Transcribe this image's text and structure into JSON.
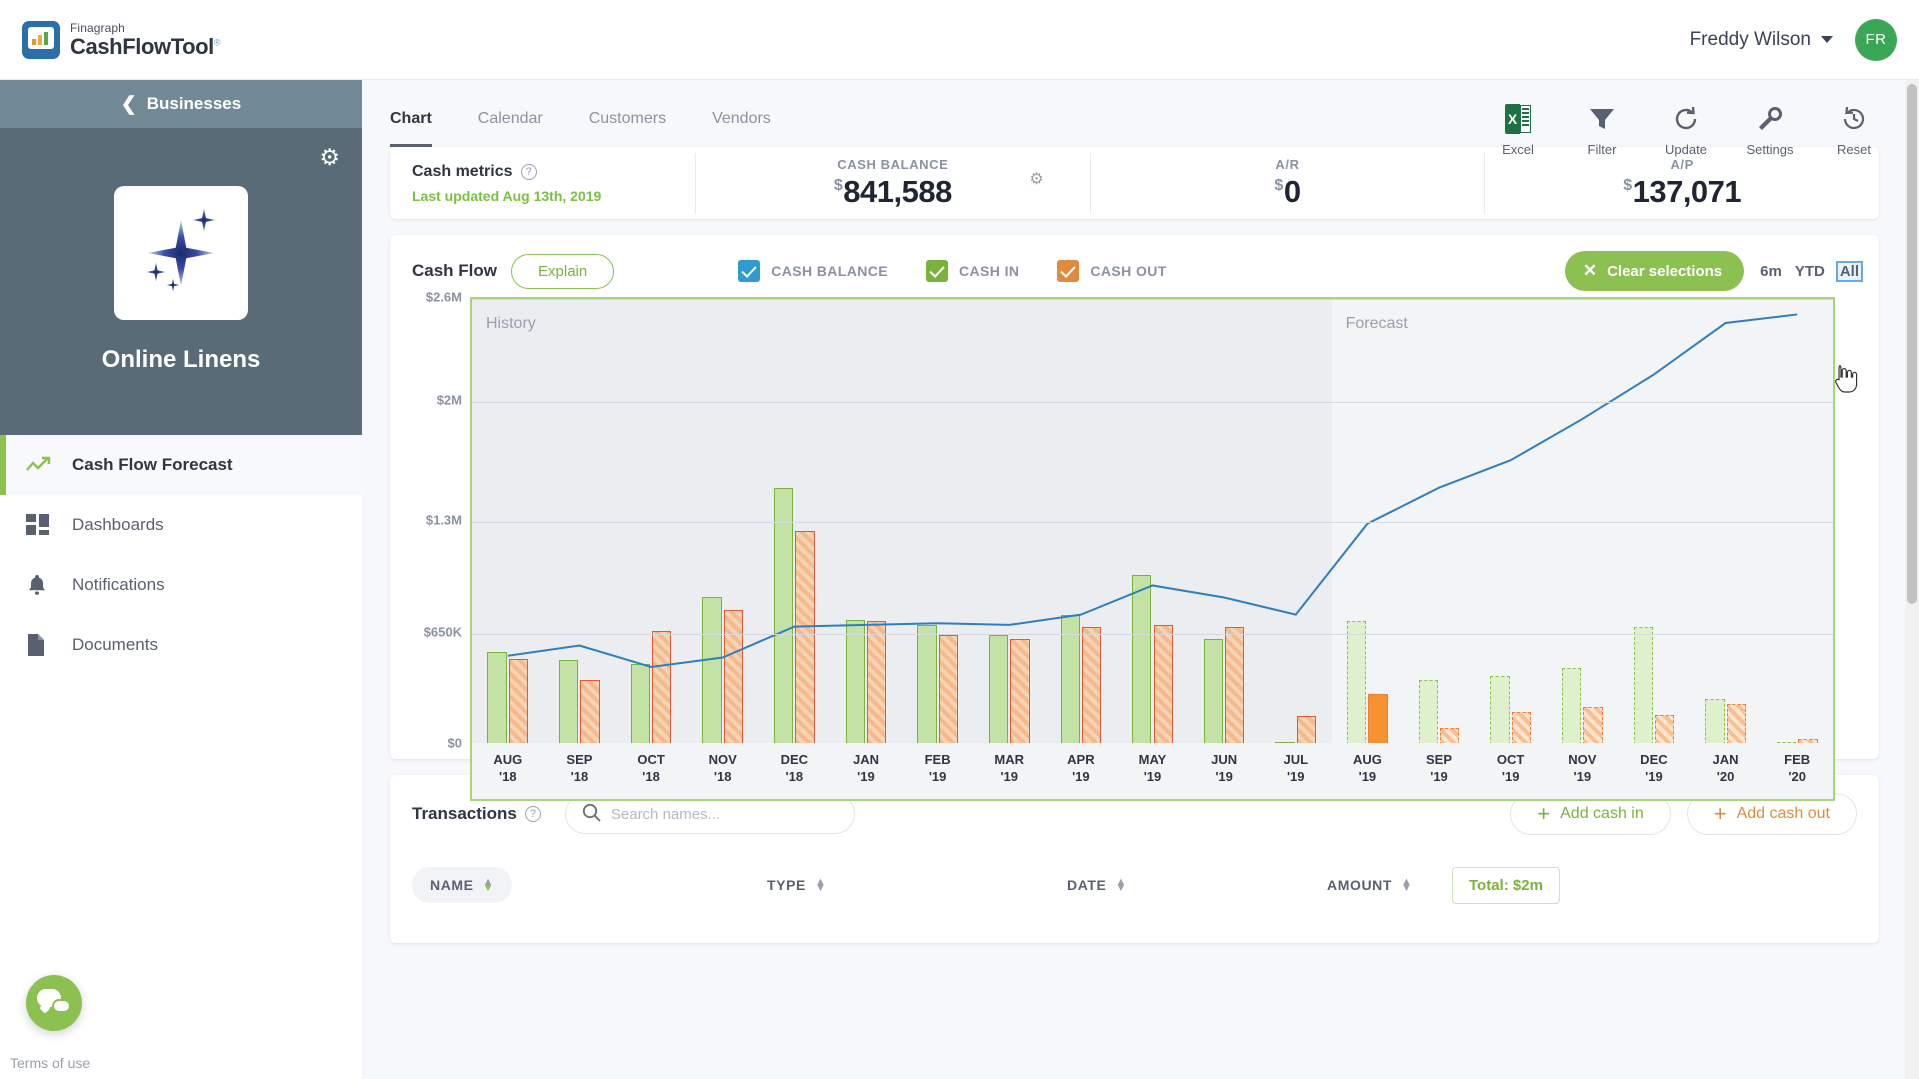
{
  "brand": {
    "top": "Finagraph",
    "bottom": "CashFlowTool",
    "tm": "®"
  },
  "topbar": {
    "user_name": "Freddy Wilson",
    "avatar_initials": "FR"
  },
  "sidebar": {
    "back_label": "Businesses",
    "business_name": "Online Linens",
    "items": [
      {
        "label": "Cash Flow Forecast",
        "icon": "trend-up-icon"
      },
      {
        "label": "Dashboards",
        "icon": "grid-icon"
      },
      {
        "label": "Notifications",
        "icon": "bell-icon"
      },
      {
        "label": "Documents",
        "icon": "document-icon"
      }
    ],
    "terms": "Terms of use"
  },
  "tabs": [
    {
      "label": "Chart",
      "active": true
    },
    {
      "label": "Calendar",
      "active": false
    },
    {
      "label": "Customers",
      "active": false
    },
    {
      "label": "Vendors",
      "active": false
    }
  ],
  "toolbar": [
    {
      "label": "Excel",
      "icon": "excel-icon"
    },
    {
      "label": "Filter",
      "icon": "funnel-icon"
    },
    {
      "label": "Update",
      "icon": "refresh-icon"
    },
    {
      "label": "Settings",
      "icon": "wrench-icon"
    },
    {
      "label": "Reset",
      "icon": "history-icon"
    }
  ],
  "metrics": {
    "title": "Cash metrics",
    "last_updated": "Last updated Aug 13th, 2019",
    "cells": [
      {
        "label": "CASH BALANCE",
        "dollar": "$",
        "value": "841,588"
      },
      {
        "label": "A/R",
        "dollar": "$",
        "value": "0"
      },
      {
        "label": "A/P",
        "dollar": "$",
        "value": "137,071"
      }
    ]
  },
  "chart_panel": {
    "title": "Cash Flow",
    "explain_label": "Explain",
    "legend": [
      {
        "label": "CASH BALANCE",
        "color": "#2f9bd0",
        "checked": true
      },
      {
        "label": "CASH IN",
        "color": "#7ab33c",
        "checked": true
      },
      {
        "label": "CASH OUT",
        "color": "#e08b3e",
        "checked": true
      }
    ],
    "clear_label": "Clear selections",
    "ranges": [
      {
        "label": "6m",
        "selected": false
      },
      {
        "label": "YTD",
        "selected": false
      },
      {
        "label": "All",
        "selected": true
      }
    ]
  },
  "chart_data": {
    "type": "bar",
    "title": "Cash Flow",
    "xlabel": "",
    "ylabel": "",
    "ylim": [
      0,
      2600000
    ],
    "grid": true,
    "legend_position": "top",
    "ytick_labels": [
      "$0",
      "$650K",
      "$1.3M",
      "$2M",
      "$2.6M"
    ],
    "ytick_values": [
      0,
      650000,
      1300000,
      2000000,
      2600000
    ],
    "zones": [
      {
        "label": "History",
        "from": "AUG '18",
        "to": "JUL '19"
      },
      {
        "label": "Forecast",
        "from": "AUG '19",
        "to": "FEB '20"
      }
    ],
    "categories": [
      "AUG '18",
      "SEP '18",
      "OCT '18",
      "NOV '18",
      "DEC '18",
      "JAN '19",
      "FEB '19",
      "MAR '19",
      "APR '19",
      "MAY '19",
      "JUN '19",
      "JUL '19",
      "AUG '19",
      "SEP '19",
      "OCT '19",
      "NOV '19",
      "DEC '19",
      "JAN '20",
      "FEB '20"
    ],
    "category_labels": [
      [
        "AUG",
        "'18"
      ],
      [
        "SEP",
        "'18"
      ],
      [
        "OCT",
        "'18"
      ],
      [
        "NOV",
        "'18"
      ],
      [
        "DEC",
        "'18"
      ],
      [
        "JAN",
        "'19"
      ],
      [
        "FEB",
        "'19"
      ],
      [
        "MAR",
        "'19"
      ],
      [
        "APR",
        "'19"
      ],
      [
        "MAY",
        "'19"
      ],
      [
        "JUN",
        "'19"
      ],
      [
        "JUL",
        "'19"
      ],
      [
        "AUG",
        "'19"
      ],
      [
        "SEP",
        "'19"
      ],
      [
        "OCT",
        "'19"
      ],
      [
        "NOV",
        "'19"
      ],
      [
        "DEC",
        "'19"
      ],
      [
        "JAN",
        "'20"
      ],
      [
        "FEB",
        "'20"
      ]
    ],
    "forecast_start_index": 12,
    "series": [
      {
        "name": "CASH IN",
        "type": "bar",
        "color": "#7ab33c",
        "values": [
          545000,
          495000,
          470000,
          860000,
          1500000,
          730000,
          700000,
          640000,
          760000,
          990000,
          620000,
          20000,
          725000,
          380000,
          400000,
          450000,
          690000,
          270000,
          15000
        ]
      },
      {
        "name": "CASH OUT",
        "type": "bar",
        "color": "#e08b3e",
        "values": [
          500000,
          380000,
          665000,
          790000,
          1250000,
          725000,
          640000,
          620000,
          690000,
          700000,
          690000,
          170000,
          300000,
          100000,
          195000,
          220000,
          175000,
          240000,
          35000
        ]
      },
      {
        "name": "CASH BALANCE",
        "type": "line",
        "color": "#2f7fc0",
        "values": [
          520000,
          580000,
          455000,
          510000,
          690000,
          700000,
          710000,
          700000,
          760000,
          930000,
          860000,
          760000,
          1290000,
          1500000,
          1660000,
          1900000,
          2160000,
          2460000,
          2510000
        ]
      }
    ]
  },
  "transactions": {
    "title": "Transactions",
    "search_placeholder": "Search names...",
    "search_value": "",
    "add_cash_in": "Add cash in",
    "add_cash_out": "Add cash out",
    "columns": [
      {
        "label": "NAME"
      },
      {
        "label": "TYPE"
      },
      {
        "label": "DATE"
      },
      {
        "label": "AMOUNT"
      }
    ],
    "total_label": "Total: $2m"
  }
}
